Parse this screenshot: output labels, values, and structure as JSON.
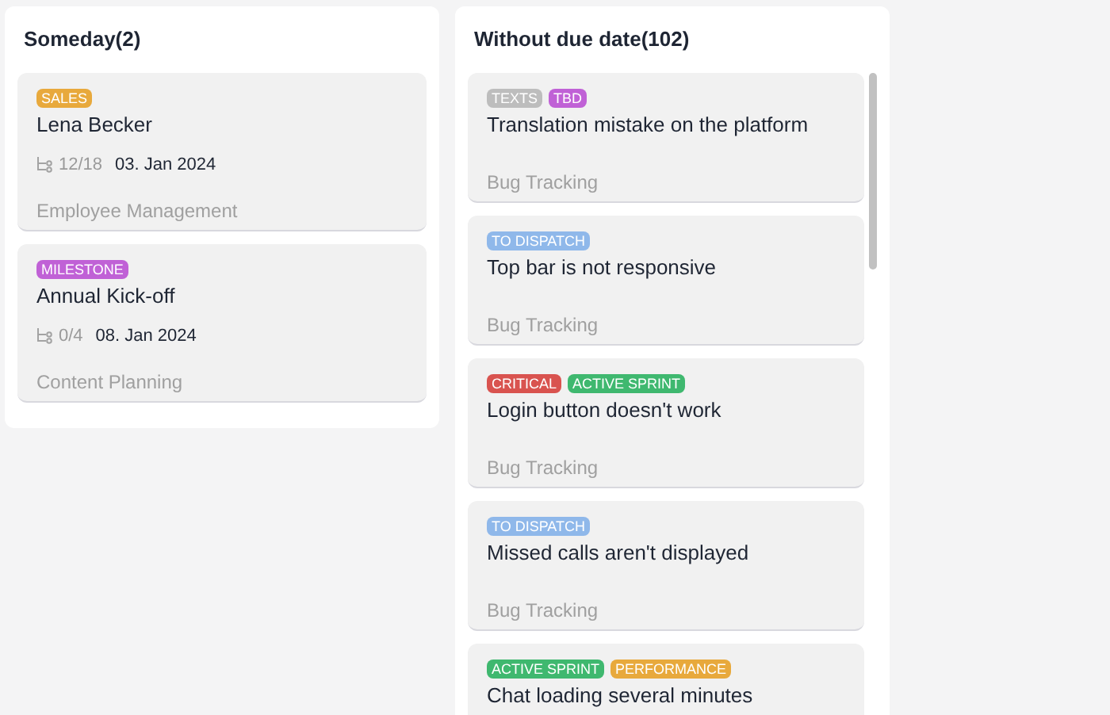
{
  "columns": [
    {
      "title": "Someday(2)",
      "cards": [
        {
          "tags": [
            {
              "text": "SALES",
              "color": "#e8a93c"
            }
          ],
          "title": "Lena Becker",
          "subtasks": "12/18",
          "date": "03. Jan 2024",
          "project": "Employee Management"
        },
        {
          "tags": [
            {
              "text": "MILESTONE",
              "color": "#c061d6"
            }
          ],
          "title": "Annual Kick-off",
          "subtasks": "0/4",
          "date": "08. Jan 2024",
          "project": "Content Planning"
        }
      ]
    },
    {
      "title": "Without due date(102)",
      "scrollable": true,
      "cards": [
        {
          "tags": [
            {
              "text": "TEXTS",
              "color": "#bdbdbd"
            },
            {
              "text": "TBD",
              "color": "#c061d6"
            }
          ],
          "title": "Translation mistake on the platform",
          "project": "Bug Tracking"
        },
        {
          "tags": [
            {
              "text": "TO DISPATCH",
              "color": "#8fb8ea"
            }
          ],
          "title": "Top bar is not responsive",
          "project": "Bug Tracking"
        },
        {
          "tags": [
            {
              "text": "CRITICAL",
              "color": "#d9534f"
            },
            {
              "text": "ACTIVE SPRINT",
              "color": "#3fb86f"
            }
          ],
          "title": "Login button doesn't work",
          "project": "Bug Tracking"
        },
        {
          "tags": [
            {
              "text": "TO DISPATCH",
              "color": "#8fb8ea"
            }
          ],
          "title": "Missed calls aren't displayed",
          "project": "Bug Tracking"
        },
        {
          "tags": [
            {
              "text": "ACTIVE SPRINT",
              "color": "#3fb86f"
            },
            {
              "text": "PERFORMANCE",
              "color": "#e8a93c"
            }
          ],
          "title": "Chat loading several minutes"
        }
      ]
    }
  ]
}
